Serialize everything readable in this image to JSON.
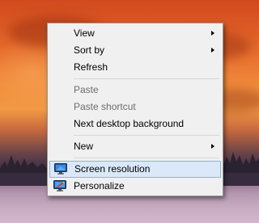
{
  "menu": {
    "items": [
      {
        "label": "View",
        "has_submenu": true,
        "disabled": false
      },
      {
        "label": "Sort by",
        "has_submenu": true,
        "disabled": false
      },
      {
        "label": "Refresh",
        "has_submenu": false,
        "disabled": false
      },
      {
        "label": "Paste",
        "has_submenu": false,
        "disabled": true
      },
      {
        "label": "Paste shortcut",
        "has_submenu": false,
        "disabled": true
      },
      {
        "label": "Next desktop background",
        "has_submenu": false,
        "disabled": false
      },
      {
        "label": "New",
        "has_submenu": true,
        "disabled": false
      },
      {
        "label": "Screen resolution",
        "has_submenu": false,
        "disabled": false,
        "icon": "monitor-icon",
        "highlighted": true
      },
      {
        "label": "Personalize",
        "has_submenu": false,
        "disabled": false,
        "icon": "personalize-icon"
      }
    ]
  },
  "colors": {
    "menu_background": "#f0f0f0",
    "highlight_fill": "#dbe8f7",
    "highlight_border": "#8fb3dd",
    "disabled_text": "#6d6d6d"
  }
}
